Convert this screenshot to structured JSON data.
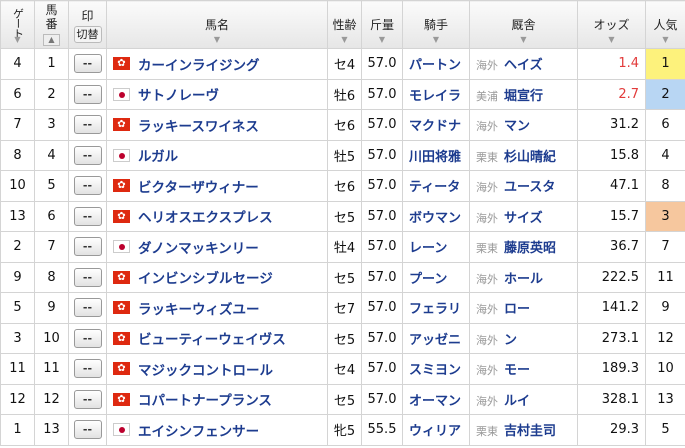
{
  "headers": {
    "gate": "ゲート",
    "umaban1": "馬",
    "umaban2": "番",
    "mark": "印",
    "mark_toggle": "切替",
    "horse": "馬名",
    "sexage": "性齢",
    "weight": "斤量",
    "jockey": "騎手",
    "trainer": "厩舎",
    "odds": "オッズ",
    "popularity": "人気"
  },
  "mark_placeholder": "--",
  "rows": [
    {
      "gate": "4",
      "num": "1",
      "flag": "hk",
      "name": "カーインライジング",
      "sexage": "セ4",
      "weight": "57.0",
      "jockey": "パートン",
      "stable": "海外",
      "trainer": "ヘイズ",
      "odds": "1.4",
      "pop": "1"
    },
    {
      "gate": "6",
      "num": "2",
      "flag": "jp",
      "name": "サトノレーヴ",
      "sexage": "牡6",
      "weight": "57.0",
      "jockey": "モレイラ",
      "stable": "美浦",
      "trainer": "堀宣行",
      "odds": "2.7",
      "pop": "2"
    },
    {
      "gate": "7",
      "num": "3",
      "flag": "hk",
      "name": "ラッキースワイネス",
      "sexage": "セ6",
      "weight": "57.0",
      "jockey": "マクドナ",
      "stable": "海外",
      "trainer": "マン",
      "odds": "31.2",
      "pop": "6"
    },
    {
      "gate": "8",
      "num": "4",
      "flag": "jp",
      "name": "ルガル",
      "sexage": "牡5",
      "weight": "57.0",
      "jockey": "川田将雅",
      "stable": "栗東",
      "trainer": "杉山晴紀",
      "odds": "15.8",
      "pop": "4"
    },
    {
      "gate": "10",
      "num": "5",
      "flag": "hk",
      "name": "ビクターザウィナー",
      "sexage": "セ6",
      "weight": "57.0",
      "jockey": "ティータ",
      "stable": "海外",
      "trainer": "ユースタ",
      "odds": "47.1",
      "pop": "8"
    },
    {
      "gate": "13",
      "num": "6",
      "flag": "hk",
      "name": "ヘリオスエクスプレス",
      "sexage": "セ5",
      "weight": "57.0",
      "jockey": "ボウマン",
      "stable": "海外",
      "trainer": "サイズ",
      "odds": "15.7",
      "pop": "3"
    },
    {
      "gate": "2",
      "num": "7",
      "flag": "jp",
      "name": "ダノンマッキンリー",
      "sexage": "牡4",
      "weight": "57.0",
      "jockey": "レーン",
      "stable": "栗東",
      "trainer": "藤原英昭",
      "odds": "36.7",
      "pop": "7"
    },
    {
      "gate": "9",
      "num": "8",
      "flag": "hk",
      "name": "インビンシブルセージ",
      "sexage": "セ5",
      "weight": "57.0",
      "jockey": "プーン",
      "stable": "海外",
      "trainer": "ホール",
      "odds": "222.5",
      "pop": "11"
    },
    {
      "gate": "5",
      "num": "9",
      "flag": "hk",
      "name": "ラッキーウィズユー",
      "sexage": "セ7",
      "weight": "57.0",
      "jockey": "フェラリ",
      "stable": "海外",
      "trainer": "ロー",
      "odds": "141.2",
      "pop": "9"
    },
    {
      "gate": "3",
      "num": "10",
      "flag": "hk",
      "name": "ビューティーウェイヴス",
      "sexage": "セ5",
      "weight": "57.0",
      "jockey": "アッゼニ",
      "stable": "海外",
      "trainer": "ン",
      "odds": "273.1",
      "pop": "12"
    },
    {
      "gate": "11",
      "num": "11",
      "flag": "hk",
      "name": "マジックコントロール",
      "sexage": "セ4",
      "weight": "57.0",
      "jockey": "スミヨン",
      "stable": "海外",
      "trainer": "モー",
      "odds": "189.3",
      "pop": "10"
    },
    {
      "gate": "12",
      "num": "12",
      "flag": "hk",
      "name": "コパートナープランス",
      "sexage": "セ5",
      "weight": "57.0",
      "jockey": "オーマン",
      "stable": "海外",
      "trainer": "ルイ",
      "odds": "328.1",
      "pop": "13"
    },
    {
      "gate": "1",
      "num": "13",
      "flag": "jp",
      "name": "エイシンフェンサー",
      "sexage": "牝5",
      "weight": "55.5",
      "jockey": "ウィリア",
      "stable": "栗東",
      "trainer": "吉村圭司",
      "odds": "29.3",
      "pop": "5"
    }
  ],
  "colors": {
    "favorite_odds": "#e23b3b",
    "pop1": "#fdf27c",
    "pop2": "#b8d6f3",
    "pop3": "#f6c79e",
    "link": "#1d3c8f"
  }
}
